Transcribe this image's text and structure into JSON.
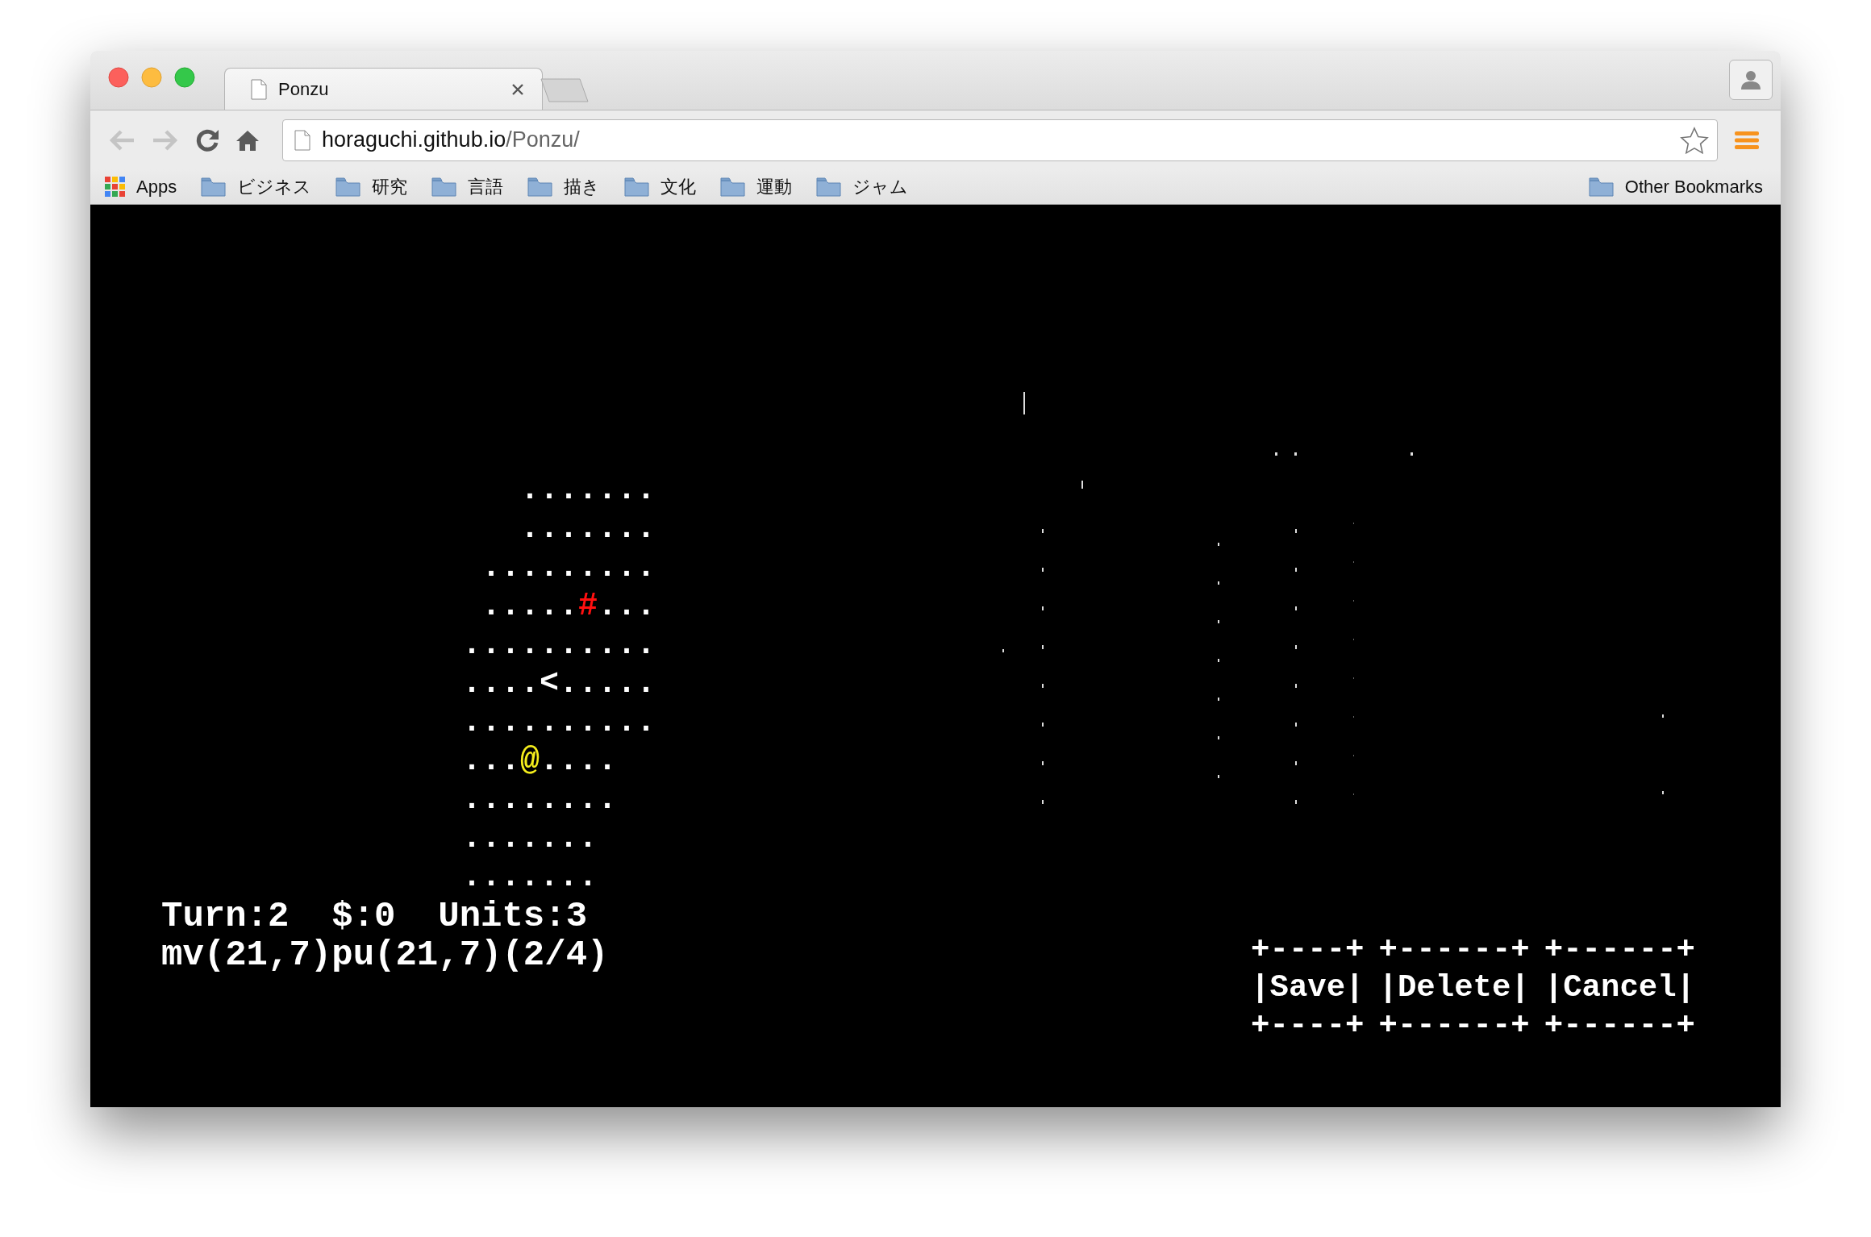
{
  "browser": {
    "tab": {
      "title": "Ponzu"
    },
    "address": {
      "host": "horaguchi.github.io",
      "path": "/Ponzu/"
    },
    "bookmarks": [
      {
        "label": "Apps",
        "kind": "apps"
      },
      {
        "label": "ビジネス",
        "kind": "folder"
      },
      {
        "label": "研究",
        "kind": "folder"
      },
      {
        "label": "言語",
        "kind": "folder"
      },
      {
        "label": "描き",
        "kind": "folder"
      },
      {
        "label": "文化",
        "kind": "folder"
      },
      {
        "label": "運動",
        "kind": "folder"
      },
      {
        "label": "ジャム",
        "kind": "folder"
      }
    ],
    "other_bookmarks": "Other Bookmarks"
  },
  "game": {
    "map": [
      {
        "text": "   .......\n   .......\n .........\n .....",
        "kind": "floor"
      },
      {
        "text": "#",
        "kind": "wall"
      },
      {
        "text": "...\n..........\n....",
        "kind": "floor"
      },
      {
        "text": "<",
        "kind": "stairs"
      },
      {
        "text": ".....\n..........\n...",
        "kind": "floor"
      },
      {
        "text": "@",
        "kind": "player"
      },
      {
        "text": "....\n........\n.......\n.......",
        "kind": "floor"
      }
    ],
    "status": [
      "Turn:2  $:0  Units:3",
      "mv(21,7)pu(21,7)(2/4)"
    ],
    "buttons": [
      {
        "lines": [
          "+----+",
          "|Save|",
          "+----+"
        ]
      },
      {
        "lines": [
          "+------+",
          "|Delete|",
          "+------+"
        ]
      },
      {
        "lines": [
          "+------+",
          "|Cancel|",
          "+------+"
        ]
      }
    ]
  }
}
